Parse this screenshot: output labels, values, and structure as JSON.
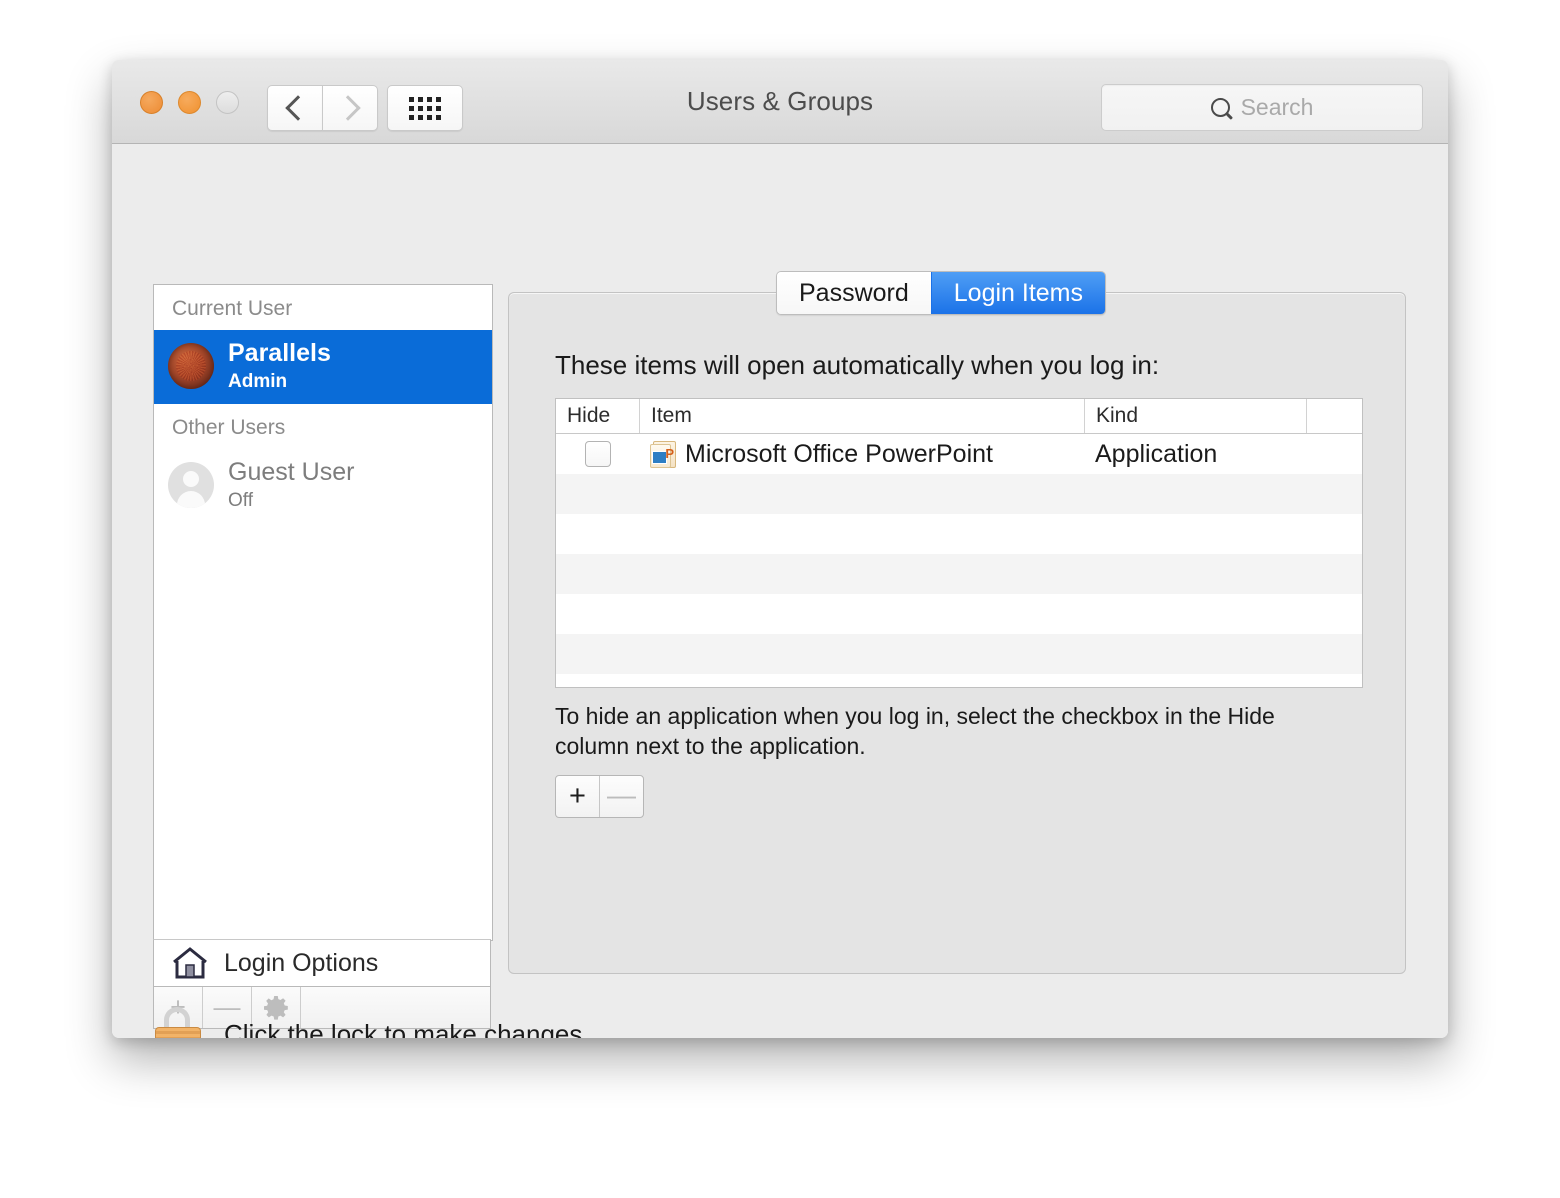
{
  "window": {
    "title": "Users & Groups",
    "traffic_lights": [
      "close-button",
      "minimize-button",
      "zoom-button"
    ],
    "nav": {
      "back": "back-button",
      "forward": "forward-button",
      "show_all": "show-all-button"
    },
    "search": {
      "placeholder": "Search",
      "value": ""
    }
  },
  "sidebar": {
    "groups": [
      {
        "header": "Current User",
        "users": [
          {
            "name": "Parallels",
            "status": "Admin",
            "avatar": "parallels-avatar",
            "selected": true
          }
        ]
      },
      {
        "header": "Other Users",
        "users": [
          {
            "name": "Guest User",
            "status": "Off",
            "avatar": "guest-avatar",
            "selected": false
          }
        ]
      }
    ],
    "login_options": {
      "label": "Login Options",
      "icon": "house-icon"
    },
    "toolbar": {
      "add": "+",
      "remove": "—",
      "settings": "gear-icon"
    }
  },
  "pane": {
    "tabs": [
      {
        "label": "Password",
        "active": false
      },
      {
        "label": "Login Items",
        "active": true
      }
    ],
    "intro": "These items will open automatically when you log in:",
    "table": {
      "columns": [
        "Hide",
        "Item",
        "Kind"
      ],
      "rows": [
        {
          "hide": false,
          "icon": "powerpoint-icon",
          "item": "Microsoft Office PowerPoint",
          "kind": "Application"
        }
      ],
      "empty_rows": 8
    },
    "hint": "To hide an application when you log in, select the checkbox in the Hide column next to the application.",
    "add_remove": {
      "add": "+",
      "remove": "—"
    }
  },
  "footer": {
    "lock_text": "Click the lock to make changes.",
    "lock_icon": "locked-padlock-icon",
    "help": "?"
  },
  "colors": {
    "accent_blue": "#0a6cd8",
    "tab_blue": "#1b72e8",
    "help_blue": "#2b82f0",
    "window_bg": "#ececec",
    "pane_bg": "#e4e4e4"
  }
}
